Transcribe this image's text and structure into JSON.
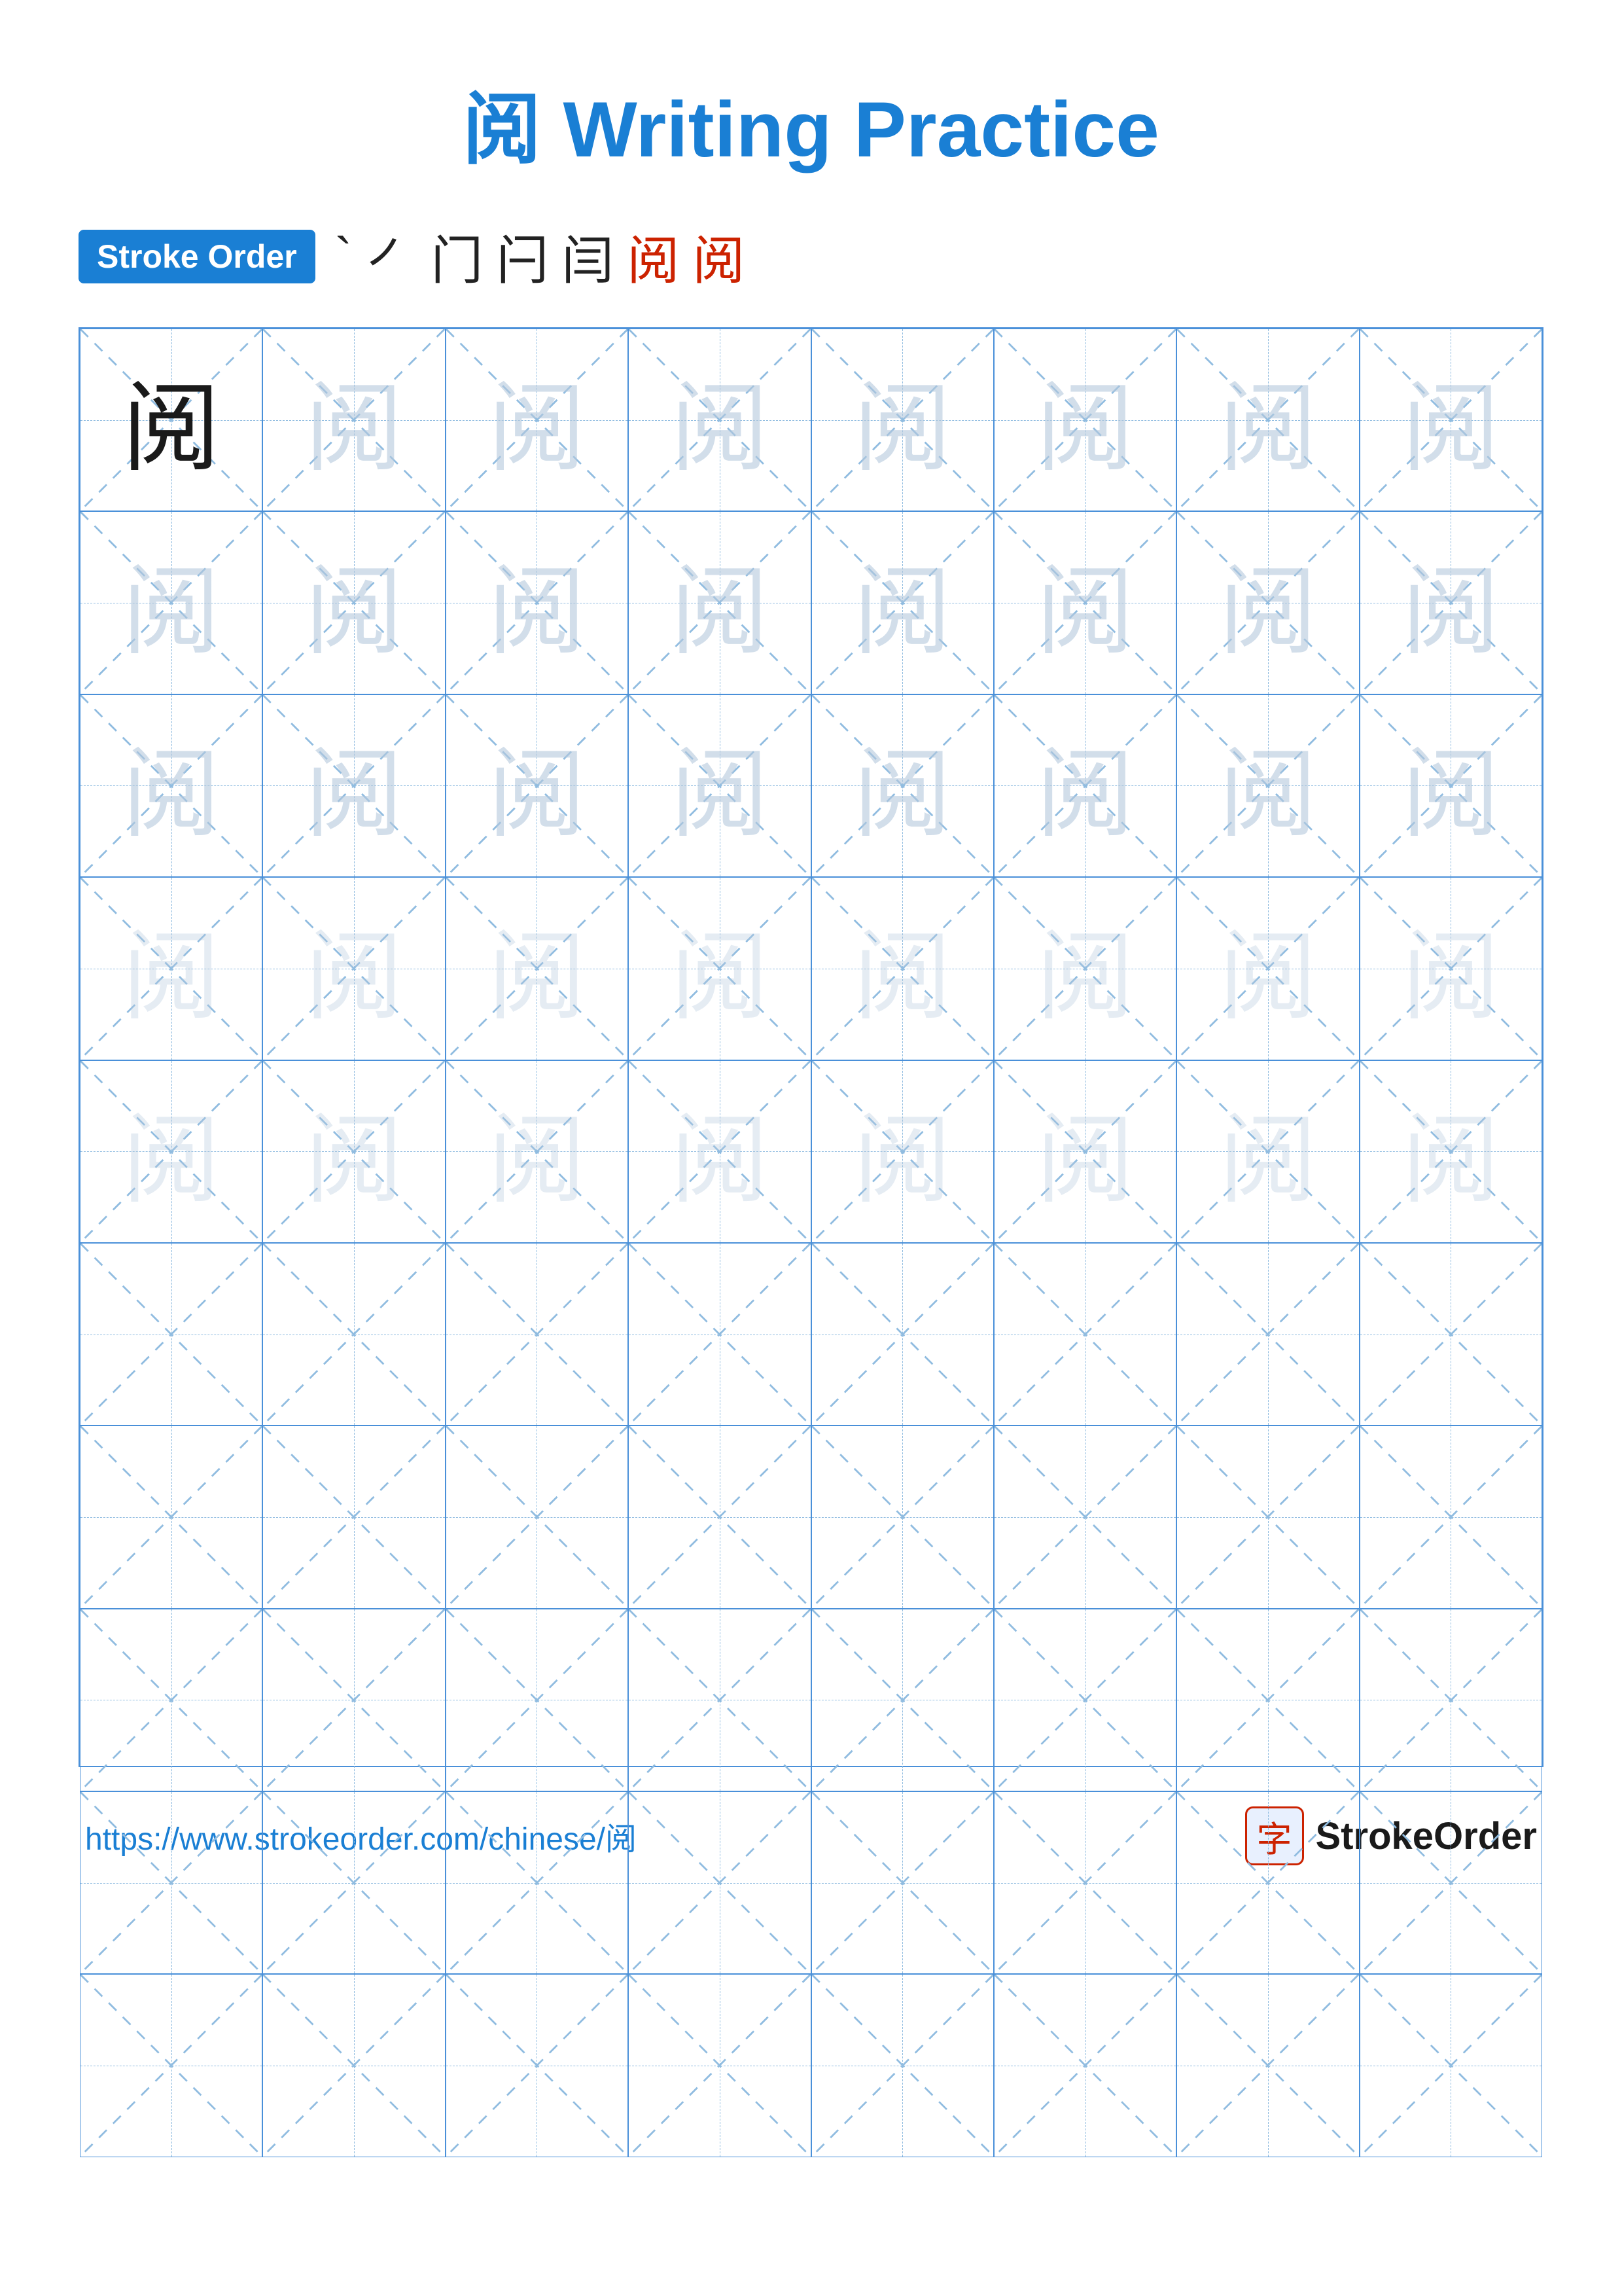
{
  "title": {
    "char": "阅",
    "text": "Writing Practice",
    "full": "阅 Writing Practice"
  },
  "stroke_order": {
    "badge_label": "Stroke Order",
    "strokes": [
      "`",
      "㇒",
      "门",
      "闩",
      "闫",
      "阅",
      "阅"
    ]
  },
  "grid": {
    "rows": 10,
    "cols": 8,
    "char": "阅",
    "solid_count": 1,
    "faint_rows": 5,
    "empty_rows": 5
  },
  "footer": {
    "url": "https://www.strokeorder.com/chinese/阅",
    "brand_icon": "字",
    "brand_name": "StrokeOrder"
  }
}
